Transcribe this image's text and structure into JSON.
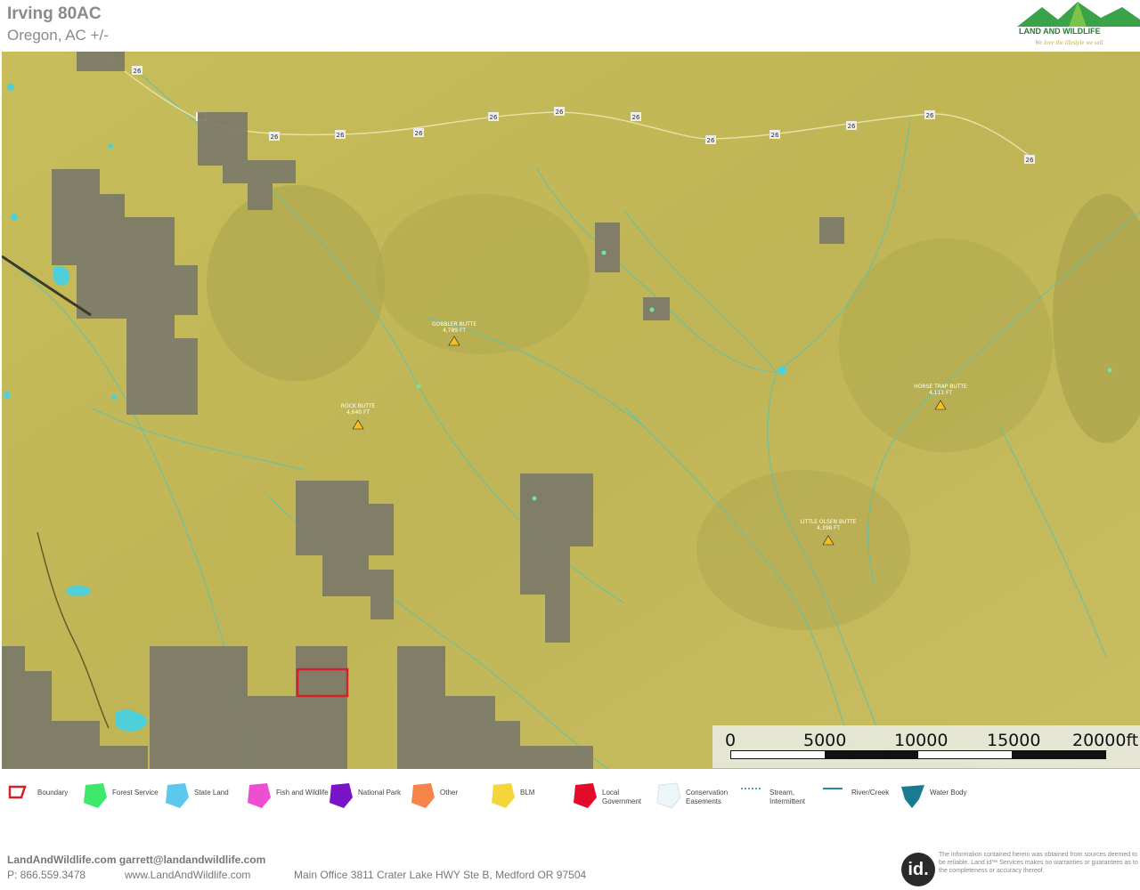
{
  "header": {
    "title": "Irving 80AC",
    "subtitle": "Oregon,  AC +/-",
    "logo_text": "LAND AND WILDLIFE",
    "logo_tagline": "We love the lifestyle we sell"
  },
  "map": {
    "highway_labels": [
      "26",
      "26",
      "26",
      "26",
      "26",
      "26",
      "26",
      "26",
      "26",
      "26",
      "26",
      "26",
      "26"
    ],
    "peaks": [
      {
        "name": "GOBBLER BUTTE",
        "elevation": "4,789 FT"
      },
      {
        "name": "ROCK BUTTE",
        "elevation": "4,640 FT"
      },
      {
        "name": "HORSE TRAP BUTTE",
        "elevation": "4,111 FT"
      },
      {
        "name": "LITTLE OLSEN BUTTE",
        "elevation": "4,398 FT"
      }
    ],
    "colors": {
      "blm": "#c9bd58",
      "private_land": "#7c7969",
      "boundary": "#d42026",
      "water": "#4fd0d8"
    }
  },
  "scale": {
    "labels": [
      "0",
      "5000",
      "10000",
      "15000",
      "20000ft"
    ]
  },
  "legend": [
    {
      "label": "Boundary",
      "icon": "boundary-icon",
      "color": "#d42026"
    },
    {
      "label": "Forest Service",
      "icon": "forest-service-icon",
      "color": "#3de86a"
    },
    {
      "label": "State Land",
      "icon": "state-land-icon",
      "color": "#5cc8ee"
    },
    {
      "label": "Fish and Wildlife",
      "icon": "fish-wildlife-icon",
      "color": "#ee4fd0"
    },
    {
      "label": "National Park",
      "icon": "national-park-icon",
      "color": "#7a14c8"
    },
    {
      "label": "Other",
      "icon": "other-icon",
      "color": "#f7844a"
    },
    {
      "label": "BLM",
      "icon": "blm-icon",
      "color": "#f4d63a"
    },
    {
      "label": "Local Government",
      "icon": "local-government-icon",
      "color": "#e20b2a"
    },
    {
      "label": "Conservation Easements",
      "icon": "conservation-easements-icon",
      "color": "#e8f2f6"
    },
    {
      "label": "Stream, Intermittent",
      "icon": "stream-intermittent-icon",
      "color": "#2a8aa0"
    },
    {
      "label": "River/Creek",
      "icon": "river-creek-icon",
      "color": "#2a8aa0"
    },
    {
      "label": "Water Body",
      "icon": "water-body-icon",
      "color": "#1a7a92"
    }
  ],
  "footer": {
    "line1": "LandAndWildlife.com garrett@landandwildlife.com",
    "phone": "P: 866.559.3478",
    "website": "www.LandAndWildlife.com",
    "address": "Main Office 3811 Crater Lake HWY Ste B, Medford OR 97504",
    "id_logo": "id.",
    "disclaimer": "The information contained herein was obtained from sources deemed to be reliable. Land id™ Services makes no warranties or guarantees as to the completeness or accuracy thereof."
  }
}
